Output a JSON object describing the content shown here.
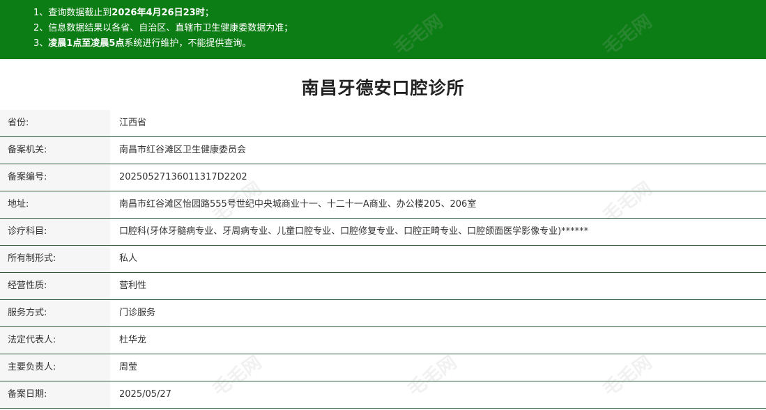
{
  "notice": {
    "line1_prefix": "1、查询数据截止到",
    "line1_bold": "2026年4月26日23时",
    "line1_suffix": "；",
    "line2": "2、信息数据结果以各省、自治区、直辖市卫生健康委数据为准；",
    "line3_prefix": "3、",
    "line3_bold": "凌晨1点至凌晨5点",
    "line3_suffix": "系统进行维护，不能提供查询。"
  },
  "title": "南昌牙德安口腔诊所",
  "rows": [
    {
      "label": "省份:",
      "value": "江西省"
    },
    {
      "label": "备案机关:",
      "value": "南昌市红谷滩区卫生健康委员会"
    },
    {
      "label": "备案编号:",
      "value": "20250527136011317D2202"
    },
    {
      "label": "地址:",
      "value": "南昌市红谷滩区怡园路555号世纪中央城商业十一、十二十一A商业、办公楼205、206室"
    },
    {
      "label": "诊疗科目:",
      "value": "口腔科(牙体牙髓病专业、牙周病专业、儿童口腔专业、口腔修复专业、口腔正畸专业、口腔颌面医学影像专业)******"
    },
    {
      "label": "所有制形式:",
      "value": "私人"
    },
    {
      "label": "经营性质:",
      "value": "营利性"
    },
    {
      "label": "服务方式:",
      "value": "门诊服务"
    },
    {
      "label": "法定代表人:",
      "value": "杜华龙"
    },
    {
      "label": "主要负责人:",
      "value": "周莹"
    },
    {
      "label": "备案日期:",
      "value": "2025/05/27"
    }
  ],
  "watermark": {
    "text": "毛毛网"
  },
  "colors": {
    "notice_bg": "#0c7d14",
    "row_border": "#2f5b3a",
    "label_bg": "#f6f6f6"
  }
}
